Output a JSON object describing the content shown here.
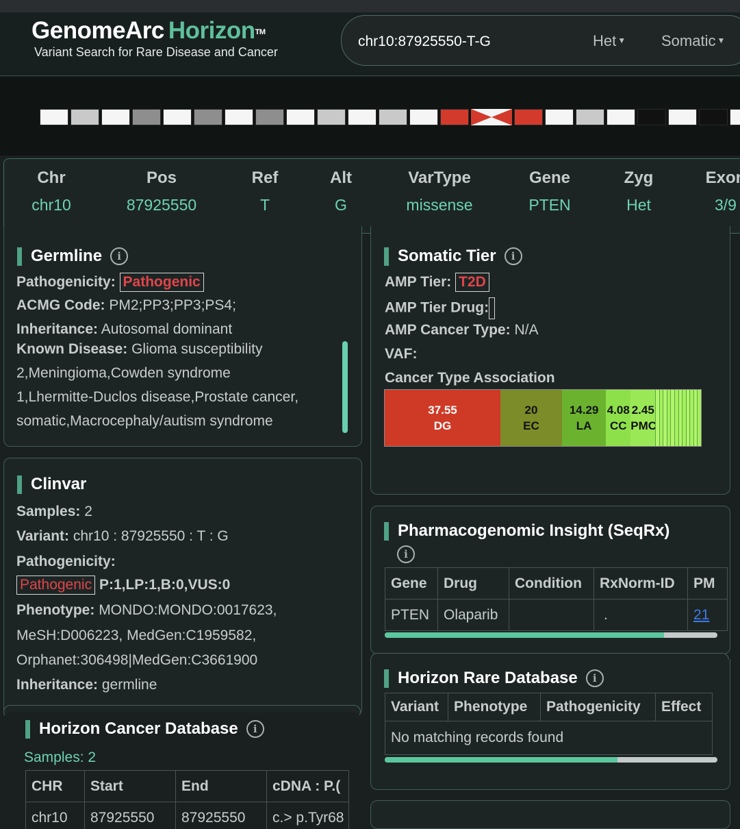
{
  "app": {
    "name_part1": "GenomeArc",
    "name_part2": "Horizon",
    "trademark": "TM",
    "subtitle": "Variant Search for Rare Disease and Cancer"
  },
  "search": {
    "value": "chr10:87925550-T-G",
    "zygosity_filter": "Het",
    "type_filter": "Somatic"
  },
  "chromosome_bands": [
    {
      "color": "#f5f5f5"
    },
    {
      "color": "#c9c9c9"
    },
    {
      "color": "#f5f5f5"
    },
    {
      "color": "#8e8e8e"
    },
    {
      "color": "#f5f5f5"
    },
    {
      "color": "#8e8e8e"
    },
    {
      "color": "#f5f5f5"
    },
    {
      "color": "#8e8e8e"
    },
    {
      "color": "#f5f5f5"
    },
    {
      "color": "#c9c9c9"
    },
    {
      "color": "#f5f5f5"
    },
    {
      "color": "#c9c9c9"
    },
    {
      "color": "#f5f5f5"
    },
    {
      "color": "#d33a2c"
    },
    {
      "color": "centromere"
    },
    {
      "color": "#d33a2c"
    },
    {
      "color": "#f5f5f5"
    },
    {
      "color": "#c9c9c9"
    },
    {
      "color": "#f5f5f5"
    },
    {
      "color": "#111111"
    },
    {
      "color": "#f5f5f5"
    },
    {
      "color": "#111111"
    },
    {
      "color": "#f5f5f5"
    }
  ],
  "summary": {
    "columns": [
      {
        "header": "Chr",
        "value": "chr10"
      },
      {
        "header": "Pos",
        "value": "87925550"
      },
      {
        "header": "Ref",
        "value": "T"
      },
      {
        "header": "Alt",
        "value": "G"
      },
      {
        "header": "VarType",
        "value": "missense"
      },
      {
        "header": "Gene",
        "value": "PTEN"
      },
      {
        "header": "Zyg",
        "value": "Het"
      },
      {
        "header": "Exon",
        "value": "3/9"
      }
    ]
  },
  "germline": {
    "title": "Germline",
    "pathogenicity_label": "Pathogenicity:",
    "pathogenicity_value": "Pathogenic",
    "acmg_label": "ACMG Code:",
    "acmg_value": "PM2;PP3;PP3;PS4;",
    "inheritance_label": "Inheritance:",
    "inheritance_value": "Autosomal dominant",
    "disease_label": "Known Disease:",
    "disease_line1": "Glioma susceptibility",
    "disease_line2": "2,Meningioma,Cowden syndrome",
    "disease_line3": "1,Lhermitte-Duclos disease,Prostate cancer,",
    "disease_line4": "somatic,Macrocephaly/autism syndrome"
  },
  "somatic": {
    "title": "Somatic Tier",
    "amp_tier_label": "AMP Tier:",
    "amp_tier_value": "T2D",
    "amp_drug_label": "AMP Tier Drug:",
    "amp_cancer_label": "AMP Cancer Type:",
    "amp_cancer_value": "N/A",
    "vaf_label": "VAF:",
    "assoc_label": "Cancer Type Association",
    "cancer_types": [
      {
        "value": "37.55",
        "code": "DG",
        "color": "#cf3a26"
      },
      {
        "value": "20",
        "code": "EC",
        "color": "#7b8c28"
      },
      {
        "value": "14.29",
        "code": "LA",
        "color": "#6bb32e"
      },
      {
        "value": "4.08",
        "code": "CC",
        "color": "#8ee04a"
      },
      {
        "value": "2.45",
        "code": "PMC",
        "color": "#9be856"
      }
    ]
  },
  "clinvar": {
    "title": "Clinvar",
    "samples_label": "Samples:",
    "samples_value": "2",
    "variant_label": "Variant:",
    "variant_value": "chr10 : 87925550 : T : G",
    "pathogenicity_label": "Pathogenicity:",
    "pathogenicity_value": "Pathogenic",
    "counts": "P:1,LP:1,B:0,VUS:0",
    "phenotype_label": "Phenotype:",
    "phenotype_line1": "MONDO:MONDO:0017623,",
    "phenotype_line2": "MeSH:D006223, MedGen:C1959582,",
    "phenotype_line3": "Orphanet:306498|MedGen:C3661900",
    "inheritance_label": "Inheritance:",
    "inheritance_value": "germline"
  },
  "pharmacogenomic": {
    "title": "Pharmacogenomic Insight (SeqRx)",
    "headers": [
      "Gene",
      "Drug",
      "Condition",
      "RxNorm-ID",
      "PM"
    ],
    "row": [
      "PTEN",
      "Olaparib",
      "",
      ".",
      "21"
    ],
    "scroll_progress": 0.84
  },
  "horizon_rare": {
    "title": "Horizon Rare Database",
    "headers": [
      "Variant",
      "Phenotype",
      "Pathogenicity",
      "Effect"
    ],
    "empty_message": "No matching records found",
    "scroll_progress": 0.7
  },
  "horizon_cancer": {
    "title": "Horizon Cancer Database",
    "samples_label": "Samples:",
    "samples_value": "2",
    "headers": [
      "CHR",
      "Start",
      "End",
      "cDNA : P.("
    ],
    "row": [
      "chr10",
      "87925550",
      "87925550",
      "c.> p.Tyr68"
    ]
  }
}
